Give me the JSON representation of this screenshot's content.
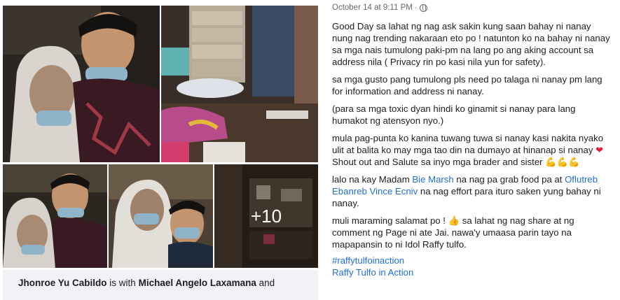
{
  "post": {
    "date": "October 14 at 9:11 PM",
    "sep": "·",
    "paragraphs": {
      "p1": "Good Day sa lahat ng nag ask sakin kung saan bahay ni nanay nung nag trending nakaraan eto po ! natunton ko na bahay ni nanay sa mga nais tumulong paki-pm na lang po ang aking account sa address nila ( Privacy rin po kasi nila yun for safety).",
      "p2": "sa mga gusto pang tumulong pls need po talaga ni nanay pm lang for information and address ni nanay.",
      "p3": "(para sa mga toxic dyan hindi ko ginamit si nanay para lang humakot ng atensyon nyo.)",
      "p4_a": "mula pag-punta ko kanina tuwang tuwa si nanay kasi nakita nyako ulit at balita ko may mga tao din na dumayo at hinanap si nanay",
      "p4_heart": "❤",
      "p4_b": "Shout out and Salute sa inyo mga brader and sister",
      "p4_emoji": "💪💪💪",
      "p5_a": "lalo na kay Madam",
      "p5_link1": "Bie Marsh",
      "p5_b": "na nag pa grab food pa at",
      "p5_link2": "Oflutreb Ebanreb Vince Ecniv",
      "p5_c": "na nag effort para ituro saken yung bahay ni nanay.",
      "p6_a": "muli maraming salamat po !",
      "p6_emoji": "👍",
      "p6_b": "sa lahat ng nag share at ng comment ng Page ni ate Jai. nawa'y umaasa parin tayo na mapapansin to ni Idol Raffy tulfo."
    },
    "hashtag": "#raffytulfoinaction",
    "page_link": "Raffy Tulfo in Action"
  },
  "gallery": {
    "more_count": "+10",
    "caption_author": "Jhonroe Yu Cabildo",
    "caption_mid": "is with",
    "caption_tagged": "Michael Angelo Laxamana",
    "caption_end": "and"
  }
}
